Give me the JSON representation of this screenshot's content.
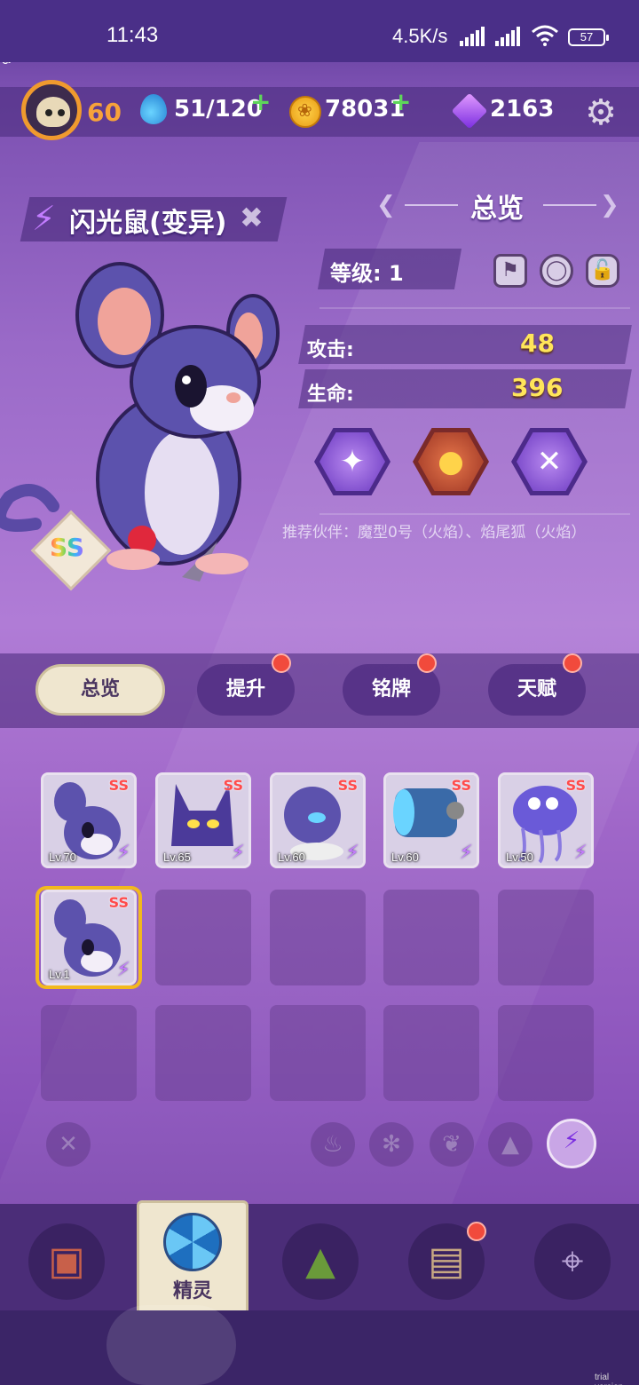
{
  "status_bar": {
    "time": "11:43",
    "network_speed": "4.5K/s",
    "battery": "57"
  },
  "resources": {
    "player_level": "60",
    "energy": "51/120",
    "coins": "78031",
    "gems": "2163"
  },
  "pet": {
    "name": "闪光鼠(变异)",
    "rarity": "SS",
    "level_label": "等级: 1",
    "attack_label": "攻击:",
    "attack_value": "48",
    "hp_label": "生命:",
    "hp_value": "396",
    "recommended": "推荐伙伴：魔型0号（火焰）、焰尾狐（火焰）"
  },
  "overview": {
    "title": "总览"
  },
  "tabs": [
    {
      "label": "总览",
      "active": true,
      "badge": false
    },
    {
      "label": "提升",
      "active": false,
      "badge": true
    },
    {
      "label": "铭牌",
      "active": false,
      "badge": true
    },
    {
      "label": "天赋",
      "active": false,
      "badge": true
    }
  ],
  "cards": [
    {
      "level": "Lv.70",
      "rarity": "SS"
    },
    {
      "level": "Lv.65",
      "rarity": "SS"
    },
    {
      "level": "Lv.60",
      "rarity": "SS"
    },
    {
      "level": "Lv.60",
      "rarity": "SS"
    },
    {
      "level": "Lv.50",
      "rarity": "SS"
    },
    {
      "level": "Lv.1",
      "rarity": "SS"
    }
  ],
  "filters": [
    "close-icon",
    "fire-icon",
    "flower-icon",
    "leaf-icon",
    "rock-icon",
    "lightning-icon"
  ],
  "bottom_nav": [
    {
      "icon": "console-icon",
      "label": ""
    },
    {
      "icon": "aperture-icon",
      "label": "精灵"
    },
    {
      "icon": "mountain-icon",
      "label": ""
    },
    {
      "icon": "chest-icon",
      "label": ""
    },
    {
      "icon": "map-pin-icon",
      "label": ""
    }
  ],
  "watermark": "trial version",
  "colors": {
    "accent_gold": "#ffe55a",
    "badge_red": "#f14a3c",
    "lightning_purple": "#c27cff"
  }
}
